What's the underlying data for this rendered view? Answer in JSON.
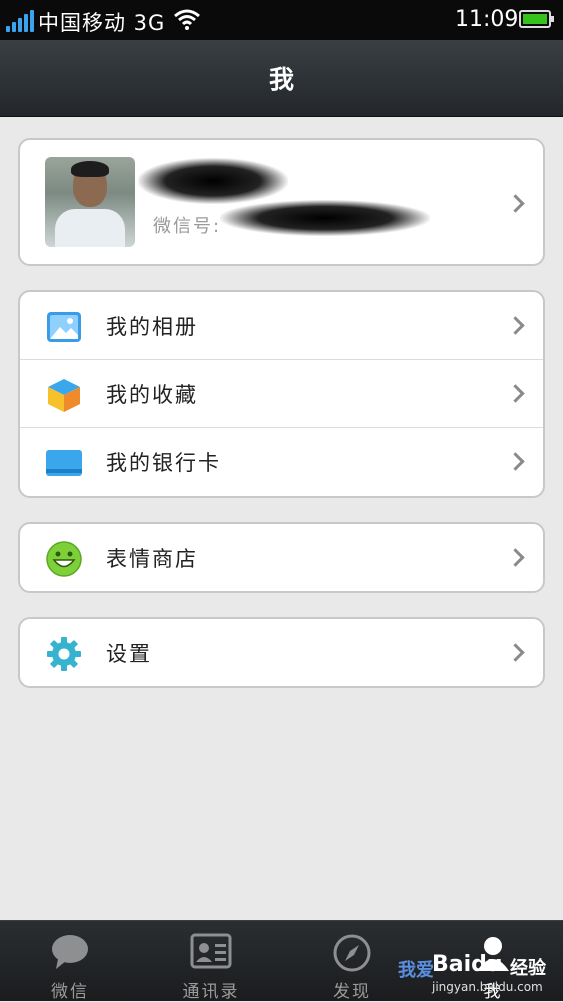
{
  "status_bar": {
    "carrier": "中国移动 3G",
    "time": "11:09"
  },
  "header": {
    "title": "我"
  },
  "profile": {
    "wechat_id_label": "微信号:"
  },
  "menu_group_1": [
    {
      "label": "我的相册",
      "icon": "photo-album-icon"
    },
    {
      "label": "我的收藏",
      "icon": "favorites-cube-icon"
    },
    {
      "label": "我的银行卡",
      "icon": "bank-card-icon"
    }
  ],
  "menu_group_2": [
    {
      "label": "表情商店",
      "icon": "smiley-icon"
    }
  ],
  "menu_group_3": [
    {
      "label": "设置",
      "icon": "gear-icon"
    }
  ],
  "tabs": [
    {
      "label": "微信",
      "icon": "chat-bubble-icon"
    },
    {
      "label": "通讯录",
      "icon": "contacts-card-icon"
    },
    {
      "label": "发现",
      "icon": "compass-icon"
    },
    {
      "label": "我",
      "icon": "person-icon",
      "active": true
    }
  ],
  "watermark": {
    "prefix": "我爱",
    "brand": "Baidu",
    "suffix": "经验",
    "url": "jingyan.baidu.com"
  },
  "colors": {
    "accent_blue": "#39a3f0",
    "battery_green": "#35c21b",
    "background": "#e9e9ea",
    "header_bg": "#2c3034"
  }
}
